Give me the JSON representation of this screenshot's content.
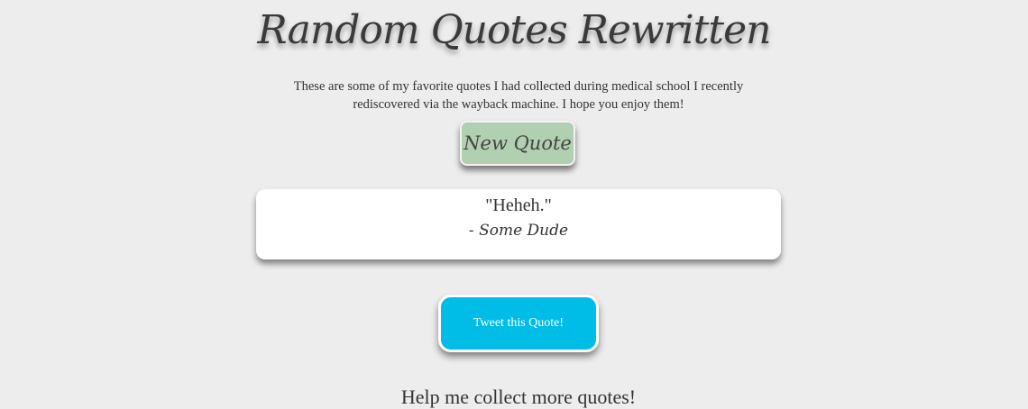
{
  "header": {
    "title": "Random Quotes Rewritten",
    "intro": "These are some of my favorite quotes I had collected during medical school I recently rediscovered via the wayback machine. I hope you enjoy them!"
  },
  "buttons": {
    "new_quote": "New Quote",
    "tweet": "Tweet this Quote!"
  },
  "quote": {
    "text": "\"Heheh.\"",
    "author": "- Some Dude"
  },
  "footer": {
    "help": "Help me collect more quotes!"
  },
  "colors": {
    "background": "#ededed",
    "new_quote_button": "#b1cfb1",
    "tweet_button": "#00bde8"
  }
}
